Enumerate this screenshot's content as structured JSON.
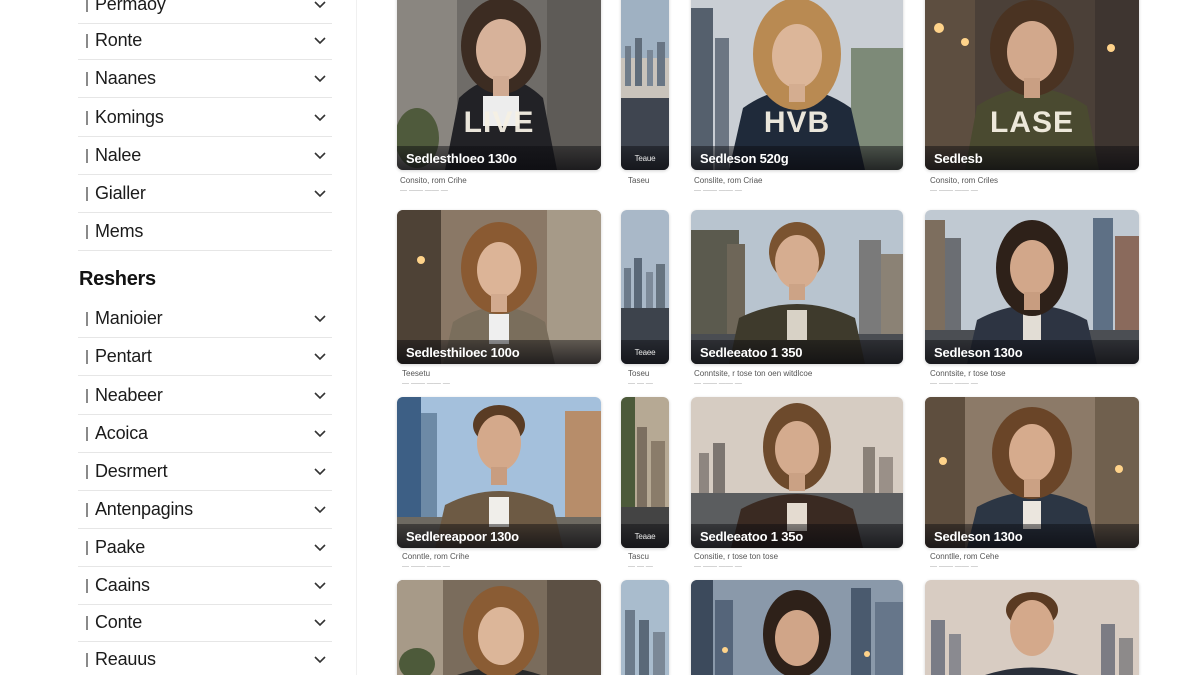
{
  "sidebar": {
    "items_top": [
      {
        "label": "Permaoy"
      },
      {
        "label": "Ronte"
      },
      {
        "label": "Naanes"
      },
      {
        "label": "Komings"
      },
      {
        "label": "Nalee"
      },
      {
        "label": "Gialler"
      },
      {
        "label": "Mems"
      }
    ],
    "heading": "Reshers",
    "items_bottom": [
      {
        "label": "Manioier"
      },
      {
        "label": "Pentart"
      },
      {
        "label": "Neabeer"
      },
      {
        "label": "Acoica"
      },
      {
        "label": "Desrmert"
      },
      {
        "label": "Antenpagins"
      },
      {
        "label": "Paake"
      },
      {
        "label": "Caains"
      },
      {
        "label": "Conte"
      },
      {
        "label": "Reauus"
      }
    ]
  },
  "grid": {
    "rows": [
      {
        "cards": [
          {
            "caption": "Sedlesthloeo 130o",
            "overlay": "LIVE",
            "meta": "Consito, rom Crihe",
            "meta_sub": "— —— —— —"
          },
          {
            "caption": "Teaue",
            "overlay": "",
            "meta": "Taseu",
            "meta_sub": ""
          },
          {
            "caption": "Sedleson 520g",
            "overlay": "HVB",
            "meta": "Conslite, rom Criae",
            "meta_sub": "— —— —— —"
          },
          {
            "caption": "Sedlesb",
            "overlay": "LASE",
            "meta": "Consito, rom Criles",
            "meta_sub": "— —— —— —"
          }
        ]
      },
      {
        "cards": [
          {
            "caption": "Sedlesthiloec 100o",
            "overlay": "",
            "meta": "Teesetu",
            "meta_sub": "— —— —— —"
          },
          {
            "caption": "Teaee",
            "overlay": "",
            "meta": "Toseu",
            "meta_sub": "— — —"
          },
          {
            "caption": "Sedleeatoo 1 350",
            "overlay": "",
            "meta": "Conntsite, r tose ton oen witdlcoe",
            "meta_sub": "— —— —— —"
          },
          {
            "caption": "Sedleson 130o",
            "overlay": "",
            "meta": "Conntsite, r tose tose",
            "meta_sub": "— —— —— —"
          }
        ]
      },
      {
        "cards": [
          {
            "caption": "Sedlereapoor 130o",
            "overlay": "",
            "meta": "Conntle, rom Crihe",
            "meta_sub": "— —— —— —"
          },
          {
            "caption": "Teaae",
            "overlay": "",
            "meta": "Tascu",
            "meta_sub": "— — —"
          },
          {
            "caption": "Sedleeatoo 1 35o",
            "overlay": "",
            "meta": "Consitie, r tose ton tose",
            "meta_sub": "— —— —— —"
          },
          {
            "caption": "Sedleson 130o",
            "overlay": "",
            "meta": "Conntlle, rom Cehe",
            "meta_sub": "— —— —— —"
          }
        ]
      },
      {
        "cards": [
          {
            "caption": "",
            "overlay": "",
            "meta": "",
            "meta_sub": ""
          },
          {
            "caption": "",
            "overlay": "",
            "meta": "",
            "meta_sub": ""
          },
          {
            "caption": "",
            "overlay": "",
            "meta": "",
            "meta_sub": ""
          },
          {
            "caption": "",
            "overlay": "",
            "meta": "",
            "meta_sub": ""
          }
        ]
      }
    ]
  },
  "icons": {
    "grip": "grip-handle-icon",
    "chevron": "chevron-down-icon"
  },
  "colors": {
    "caption_bar": "#0a0a0e",
    "overlay_text": "#f5f0e4",
    "divider": "#e6e6e6"
  }
}
